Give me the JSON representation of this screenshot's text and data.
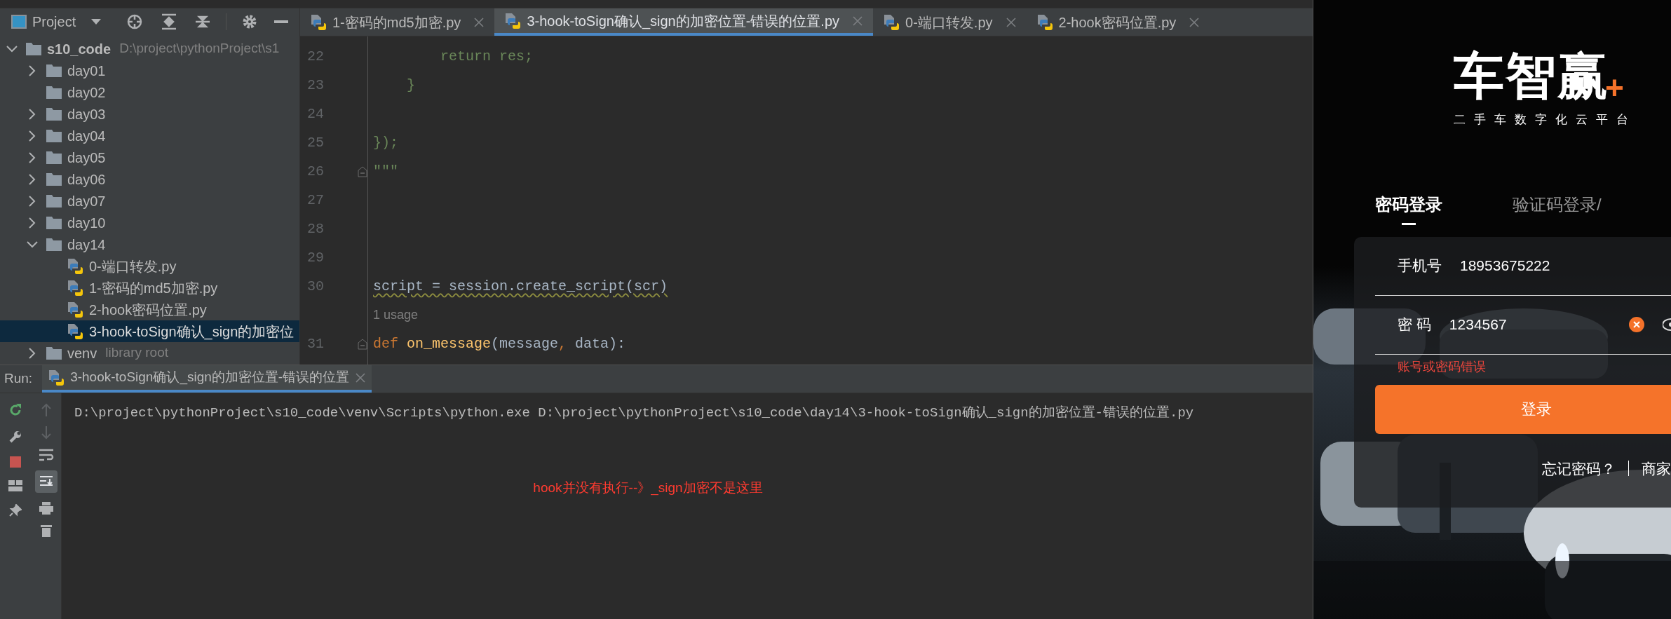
{
  "project_panel": {
    "title": "Project",
    "tree": [
      {
        "kind": "folder",
        "label": "s10_code",
        "hint": "D:\\project\\pythonProject\\s1",
        "expanded": true,
        "selected": false,
        "children": [
          {
            "kind": "folder",
            "label": "day01",
            "expanded": false,
            "selected": false
          },
          {
            "kind": "empty-folder",
            "label": "day02",
            "selected": false
          },
          {
            "kind": "folder",
            "label": "day03",
            "expanded": false,
            "selected": false
          },
          {
            "kind": "folder",
            "label": "day04",
            "expanded": false,
            "selected": false
          },
          {
            "kind": "folder",
            "label": "day05",
            "expanded": false,
            "selected": false
          },
          {
            "kind": "folder",
            "label": "day06",
            "expanded": false,
            "selected": false
          },
          {
            "kind": "folder",
            "label": "day07",
            "expanded": false,
            "selected": false
          },
          {
            "kind": "folder",
            "label": "day10",
            "expanded": false,
            "selected": false
          },
          {
            "kind": "folder",
            "label": "day14",
            "expanded": true,
            "selected": false,
            "children": [
              {
                "kind": "file",
                "label": "0-端口转发.py",
                "selected": false
              },
              {
                "kind": "file",
                "label": "1-密码的md5加密.py",
                "selected": false
              },
              {
                "kind": "file",
                "label": "2-hook密码位置.py",
                "selected": false
              },
              {
                "kind": "file",
                "label": "3-hook-toSign确认_sign的加密位",
                "selected": true
              }
            ]
          },
          {
            "kind": "folder",
            "label": "venv",
            "hint": "library root",
            "expanded": false,
            "selected": false
          }
        ]
      }
    ]
  },
  "editor_tabs": [
    {
      "label": "1-密码的md5加密.py",
      "selected": false
    },
    {
      "label": "3-hook-toSign确认_sign的加密位置-错误的位置.py",
      "selected": true
    },
    {
      "label": "0-端口转发.py",
      "selected": false
    },
    {
      "label": "2-hook密码位置.py",
      "selected": false
    }
  ],
  "editor": {
    "lines": [
      {
        "number": "22",
        "tokens": [
          {
            "kind": "string",
            "text": "        return res;"
          }
        ]
      },
      {
        "number": "23",
        "tokens": [
          {
            "kind": "string",
            "text": "    }"
          }
        ]
      },
      {
        "number": "24"
      },
      {
        "number": "25",
        "tokens": [
          {
            "kind": "string",
            "text": "});"
          }
        ]
      },
      {
        "number": "26",
        "fold": true,
        "tokens": [
          {
            "kind": "string",
            "text": "\"\"\""
          }
        ]
      },
      {
        "number": "27"
      },
      {
        "number": "28"
      },
      {
        "number": "29"
      },
      {
        "number": "30",
        "warning": true,
        "tokens": [
          {
            "kind": "plain",
            "text": "script = session.create_script(scr)"
          }
        ],
        "hint_after": "1 usage"
      },
      {
        "number": "31",
        "fold": true,
        "tokens": [
          {
            "kind": "keyword",
            "text": "def "
          },
          {
            "kind": "function",
            "text": "on_message"
          },
          {
            "kind": "plain",
            "text": "(message"
          },
          {
            "kind": "keyword",
            "text": ","
          },
          {
            "kind": "plain",
            "text": " data):"
          }
        ]
      }
    ]
  },
  "run_panel": {
    "label": "Run:",
    "tab": "3-hook-toSign确认_sign的加密位置-错误的位置",
    "command": "D:\\project\\pythonProject\\s10_code\\venv\\Scripts\\python.exe D:\\project\\pythonProject\\s10_code\\day14\\3-hook-toSign确认_sign的加密位置-错误的位置.py",
    "annotation": "hook并没有执行--》_sign加密不是这里"
  },
  "phone": {
    "logo": "车智赢",
    "logo_mark": "+",
    "tagline": "二手车数字化云平台",
    "tabs": [
      {
        "label": "密码登录",
        "selected": true
      },
      {
        "label": "验证码登录/",
        "selected": false
      }
    ],
    "fields": [
      {
        "label": "手机号",
        "value": "18953675222",
        "clearable": false
      },
      {
        "label": "密 码",
        "value": "1234567",
        "clearable": true
      }
    ],
    "error": "账号或密码错误",
    "button": "登录",
    "links": [
      "忘记密码？",
      "商家"
    ]
  }
}
